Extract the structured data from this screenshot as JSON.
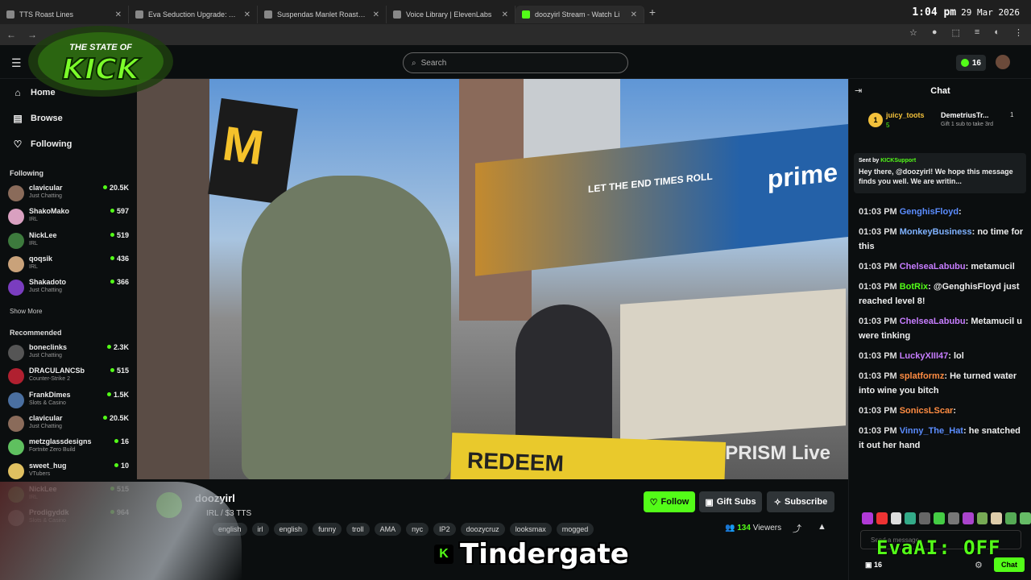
{
  "browser": {
    "tabs": [
      {
        "label": "TTS Roast Lines"
      },
      {
        "label": "Eva Seduction Upgrade: Archet"
      },
      {
        "label": "Suspendas Manlet Roasts & T"
      },
      {
        "label": "Voice Library | ElevenLabs"
      },
      {
        "label": "doozyirl Stream - Watch Li"
      }
    ],
    "new_tab": "+",
    "clock_time": "1:04 pm",
    "clock_date": "29 Mar 2026"
  },
  "logo_text": "THE STATE OF KICK",
  "topnav": {
    "search_placeholder": "Search",
    "coins": "16"
  },
  "sidebar": {
    "nav": [
      {
        "label": "Home",
        "icon": "home-icon"
      },
      {
        "label": "Browse",
        "icon": "browse-icon"
      },
      {
        "label": "Following",
        "icon": "heart-icon"
      }
    ],
    "following_header": "Following",
    "following": [
      {
        "name": "clavicular",
        "category": "Just Chatting",
        "viewers": "20.5K",
        "color": "#8a6b5a"
      },
      {
        "name": "ShakoMako",
        "category": "IRL",
        "viewers": "597",
        "color": "#d9a0c0"
      },
      {
        "name": "NickLee",
        "category": "IRL",
        "viewers": "519",
        "color": "#3d7a3d"
      },
      {
        "name": "qoqsik",
        "category": "IRL",
        "viewers": "436",
        "color": "#c9a27a"
      },
      {
        "name": "Shakadoto",
        "category": "Just Chatting",
        "viewers": "366",
        "color": "#7a3dbf"
      }
    ],
    "show_more": "Show More",
    "recommended_header": "Recommended",
    "recommended": [
      {
        "name": "boneclinks",
        "category": "Just Chatting",
        "viewers": "2.3K",
        "color": "#555"
      },
      {
        "name": "DRACULANCSb",
        "category": "Counter-Strike 2",
        "viewers": "515",
        "color": "#b02030"
      },
      {
        "name": "FrankDimes",
        "category": "Slots & Casino",
        "viewers": "1.5K",
        "color": "#4a6fa0"
      },
      {
        "name": "clavicular",
        "category": "Just Chatting",
        "viewers": "20.5K",
        "color": "#8a6b5a"
      },
      {
        "name": "metzglassdesigns",
        "category": "Fortnite Zero Build",
        "viewers": "16",
        "color": "#5fc05f"
      },
      {
        "name": "sweet_hug",
        "category": "VTubers",
        "viewers": "10",
        "color": "#e0c060"
      },
      {
        "name": "NickLee",
        "category": "IRL",
        "viewers": "515",
        "color": "#3d7a3d"
      },
      {
        "name": "Prodigyddk",
        "category": "Slots & Casino",
        "viewers": "964",
        "color": "#6a6a6a"
      }
    ]
  },
  "video": {
    "watermark": "PRISM Live",
    "billboard": "prime",
    "billboard_slogan": "LET THE END TIMES ROLL",
    "banner": "REDEEM"
  },
  "stream": {
    "channel": "doozyirl",
    "title": "IRL / $3 TTS",
    "tags": [
      "english",
      "irl",
      "english",
      "funny",
      "troll",
      "AMA",
      "nyc",
      "IP2",
      "doozycruz",
      "looksmax",
      "mogged"
    ],
    "follow_label": "Follow",
    "gift_label": "Gift Subs",
    "subscribe_label": "Subscribe",
    "viewers": "134",
    "viewers_label": "Viewers"
  },
  "overlay_text": "Tindergate",
  "overlay_k": "K",
  "chat": {
    "title": "Chat",
    "leaderboard": {
      "rank": "1",
      "user1": "juicy_toots",
      "count1": "5",
      "user2": "DemetriusTr...",
      "count2": "1",
      "note": "Gift 1 sub to take 3rd"
    },
    "pinned": {
      "sent_by": "Sent by",
      "sender": "KICKSupport",
      "message": "Hey there, @doozyirl! We hope this message finds you well. We are writin..."
    },
    "messages": [
      {
        "time": "01:03 PM",
        "user": "GenghisFloyd",
        "color": "#5b8dff",
        "text": ""
      },
      {
        "time": "01:03 PM",
        "user": "MonkeyBusiness",
        "color": "#7fb2ff",
        "text": "no time for this"
      },
      {
        "time": "01:03 PM",
        "user": "ChelseaLabubu",
        "color": "#c77dff",
        "text": "metamucil"
      },
      {
        "time": "01:03 PM",
        "user": "BotRix",
        "color": "#53fc18",
        "text": "@GenghisFloyd just reached level 8!"
      },
      {
        "time": "01:03 PM",
        "user": "ChelseaLabubu",
        "color": "#c77dff",
        "text": "Metamucil u were tinking"
      },
      {
        "time": "01:03 PM",
        "user": "LuckyXIII47",
        "color": "#c77dff",
        "text": "lol"
      },
      {
        "time": "01:03 PM",
        "user": "splatformz",
        "color": "#ff8c42",
        "text": "He turned water into wine you bitch"
      },
      {
        "time": "01:03 PM",
        "user": "SonicsLScar",
        "color": "#ff8c42",
        "text": ""
      },
      {
        "time": "01:03 PM",
        "user": "Vinny_The_Hat",
        "color": "#5b8dff",
        "text": "he snatched it out her hand"
      }
    ],
    "input_placeholder": "Send a message",
    "points": "16",
    "send_label": "Chat",
    "eva_status": "EvaAI: OFF"
  },
  "colors": {
    "accent": "#53fc18",
    "bg": "#0b0e0f"
  }
}
